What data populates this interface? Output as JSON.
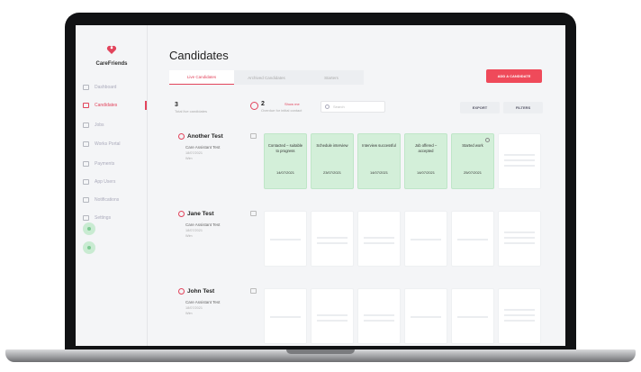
{
  "app": {
    "window_glyph": "+⊞",
    "logo_text": "CareFriends",
    "page_title": "Candidates"
  },
  "sidebar": {
    "items": [
      {
        "label": "Dashboard",
        "icon": "dashboard-icon",
        "active": false
      },
      {
        "label": "Candidates",
        "icon": "candidates-icon",
        "active": true
      },
      {
        "label": "Jobs",
        "icon": "jobs-icon",
        "active": false
      },
      {
        "label": "Works Portal",
        "icon": "portal-icon",
        "active": false
      },
      {
        "label": "Payments",
        "icon": "payments-icon",
        "active": false
      },
      {
        "label": "App Users",
        "icon": "users-icon",
        "active": false
      },
      {
        "label": "Notifications",
        "icon": "bell-icon",
        "active": false
      },
      {
        "label": "Settings",
        "icon": "gear-icon",
        "active": false
      }
    ]
  },
  "tabs": [
    "Live Candidates",
    "Archived Candidates",
    "Starters"
  ],
  "actions": {
    "add_candidate": "ADD A CANDIDATE",
    "export": "EXPORT",
    "filters": "FILTERS"
  },
  "stats": {
    "total_count": "3",
    "total_label": "Total live candidates",
    "overdue_count": "2",
    "overdue_label": "Overdue for initial contact",
    "show_me": "Show me"
  },
  "search": {
    "placeholder": "Search"
  },
  "candidates": [
    {
      "name": "Another Test",
      "role": "Care Assistant Test",
      "meta1": "18/07/2021",
      "meta2": "Wim",
      "stages": [
        {
          "label": "Contacted – suitable to progress",
          "date": "14/07/2021",
          "done": true
        },
        {
          "label": "Schedule interview",
          "date": "23/07/2021",
          "done": true
        },
        {
          "label": "Interview successful",
          "date": "14/07/2021",
          "done": true
        },
        {
          "label": "Job offered – accepted",
          "date": "14/07/2021",
          "done": true
        },
        {
          "label": "Started work",
          "date": "25/07/2021",
          "done": true
        },
        {
          "label": "",
          "date": "",
          "done": false
        }
      ]
    },
    {
      "name": "Jane Test",
      "role": "Care Assistant Test",
      "meta1": "18/07/2021",
      "meta2": "Wim",
      "stages": [
        {
          "label": "",
          "date": "",
          "done": false
        },
        {
          "label": "",
          "date": "",
          "done": false
        },
        {
          "label": "",
          "date": "",
          "done": false
        },
        {
          "label": "",
          "date": "",
          "done": false
        },
        {
          "label": "",
          "date": "",
          "done": false
        },
        {
          "label": "",
          "date": "",
          "done": false
        }
      ]
    },
    {
      "name": "John Test",
      "role": "Care Assistant Test",
      "meta1": "18/07/2021",
      "meta2": "Wim",
      "stages": [
        {
          "label": "",
          "date": "",
          "done": false
        },
        {
          "label": "",
          "date": "",
          "done": false
        },
        {
          "label": "",
          "date": "",
          "done": false
        },
        {
          "label": "",
          "date": "",
          "done": false
        },
        {
          "label": "",
          "date": "",
          "done": false
        },
        {
          "label": "",
          "date": "",
          "done": false
        }
      ]
    }
  ],
  "colors": {
    "accent": "#e2445c",
    "button": "#ef4a5a",
    "stage_done": "#d3efd9",
    "fab": "#c9ebd2"
  }
}
